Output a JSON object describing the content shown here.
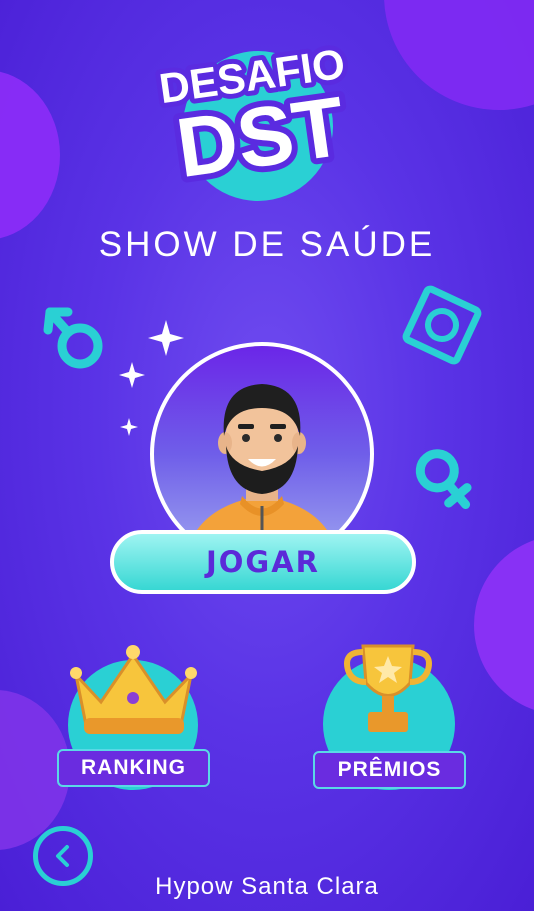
{
  "logo": {
    "line1": "DESAFIO",
    "line2": "DST"
  },
  "title": "SHOW DE SAÚDE",
  "play_button": {
    "label": "JOGAR"
  },
  "ranking": {
    "label": "RANKING",
    "icon": "crown-icon"
  },
  "prizes": {
    "label": "PRÊMIOS",
    "icon": "trophy-icon"
  },
  "back": {
    "icon": "chevron-left-icon"
  },
  "footer": "Hypow Santa Clara",
  "colors": {
    "background": "#5a33e6",
    "accent": "#2ad0d4",
    "button_text": "#5b2ad8"
  }
}
